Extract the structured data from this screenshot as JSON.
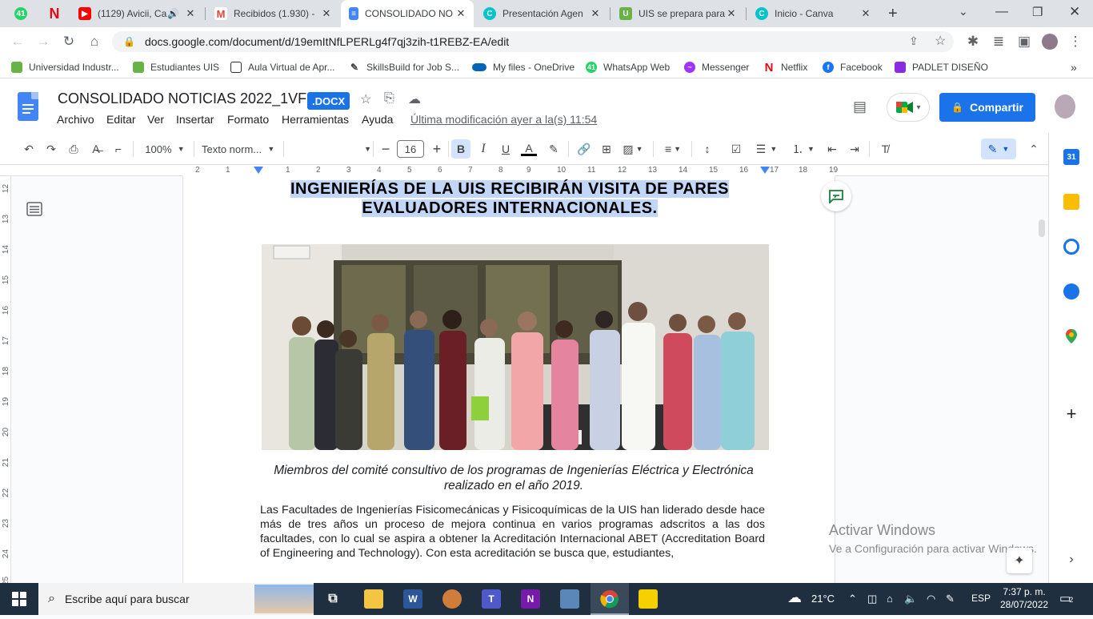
{
  "browser": {
    "tabs": [
      {
        "title": "",
        "favicon": "whatsapp-icon",
        "color": "#25d366"
      },
      {
        "title": "",
        "favicon": "netflix-icon",
        "color": "#e50914"
      },
      {
        "title": "(1129) Avicii, Ca",
        "favicon": "youtube-icon",
        "color": "#ff0000"
      },
      {
        "title": "Recibidos (1.930) - ",
        "favicon": "gmail-icon",
        "color": "#ea4335"
      },
      {
        "title": "CONSOLIDADO NO",
        "favicon": "docs-icon",
        "color": "#4285f4",
        "active": true
      },
      {
        "title": "Presentación Agen",
        "favicon": "canva-icon",
        "color": "#00c4cc"
      },
      {
        "title": "UIS se prepara para",
        "favicon": "uis-icon",
        "color": "#67b346"
      },
      {
        "title": "Inicio - Canva",
        "favicon": "canva-icon",
        "color": "#00c4cc"
      }
    ],
    "url": "docs.google.com/document/d/19emItNfLPERLg4f7qj3zih-t1REBZ-EA/edit",
    "bookmarks": [
      {
        "label": "Universidad Industr...",
        "color": "#67b346"
      },
      {
        "label": "Estudiantes UIS",
        "color": "#67b346"
      },
      {
        "label": "Aula Virtual de Apr...",
        "color": "#444"
      },
      {
        "label": "SkillsBuild for Job S...",
        "color": "#444"
      },
      {
        "label": "My files - OneDrive",
        "color": "#0364b8"
      },
      {
        "label": "WhatsApp Web",
        "color": "#25d366"
      },
      {
        "label": "Messenger",
        "color": "#a033ff"
      },
      {
        "label": "Netflix",
        "color": "#e50914"
      },
      {
        "label": "Facebook",
        "color": "#1877f2"
      },
      {
        "label": "PADLET DISEÑO",
        "color": "#8a2be2"
      }
    ]
  },
  "docs": {
    "title": "CONSOLIDADO NOTICIAS 2022_1VF",
    "badge": ".DOCX",
    "menus": [
      "Archivo",
      "Editar",
      "Ver",
      "Insertar",
      "Formato",
      "Herramientas",
      "Ayuda"
    ],
    "last_modified": "Última modificación ayer a la(s) 11:54",
    "share_label": "Compartir",
    "toolbar": {
      "zoom": "100%",
      "style": "Texto norm...",
      "font": "",
      "font_size": "16"
    },
    "ruler_numbers": [
      "2",
      "1",
      "1",
      "2",
      "3",
      "4",
      "5",
      "6",
      "7",
      "8",
      "9",
      "10",
      "11",
      "12",
      "13",
      "14",
      "15",
      "16",
      "17",
      "18",
      "19"
    ],
    "vruler_numbers": [
      "12",
      "13",
      "14",
      "15",
      "16",
      "17",
      "18",
      "19",
      "20",
      "21",
      "22",
      "23",
      "24",
      "25"
    ]
  },
  "document": {
    "headline_line1": "INGENIERÍAS DE LA UIS RECIBIRÁN VISITA DE PARES",
    "headline_line2": "EVALUADORES INTERNACIONALES.",
    "caption": "Miembros del comité consultivo de los programas de Ingenierías Eléctrica y Electrónica realizado en el año 2019.",
    "body": "Las Facultades de Ingenierías Fisicomecánicas y Fisicoquímicas de la UIS han liderado desde hace más de tres años un proceso de mejora continua en varios programas adscritos a las dos facultades, con lo cual se aspira a obtener la Acreditación Internacional ABET (Accreditation Board of Engineering and Technology). Con esta acreditación se busca que, estudiantes,"
  },
  "watermark": {
    "line1": "Activar Windows",
    "line2": "Ve a Configuración para activar Windows."
  },
  "taskbar": {
    "search_placeholder": "Escribe aquí para buscar",
    "weather": "21°C",
    "language": "ESP",
    "time": "7:37 p. m.",
    "date": "28/07/2022",
    "notifications": "2"
  }
}
